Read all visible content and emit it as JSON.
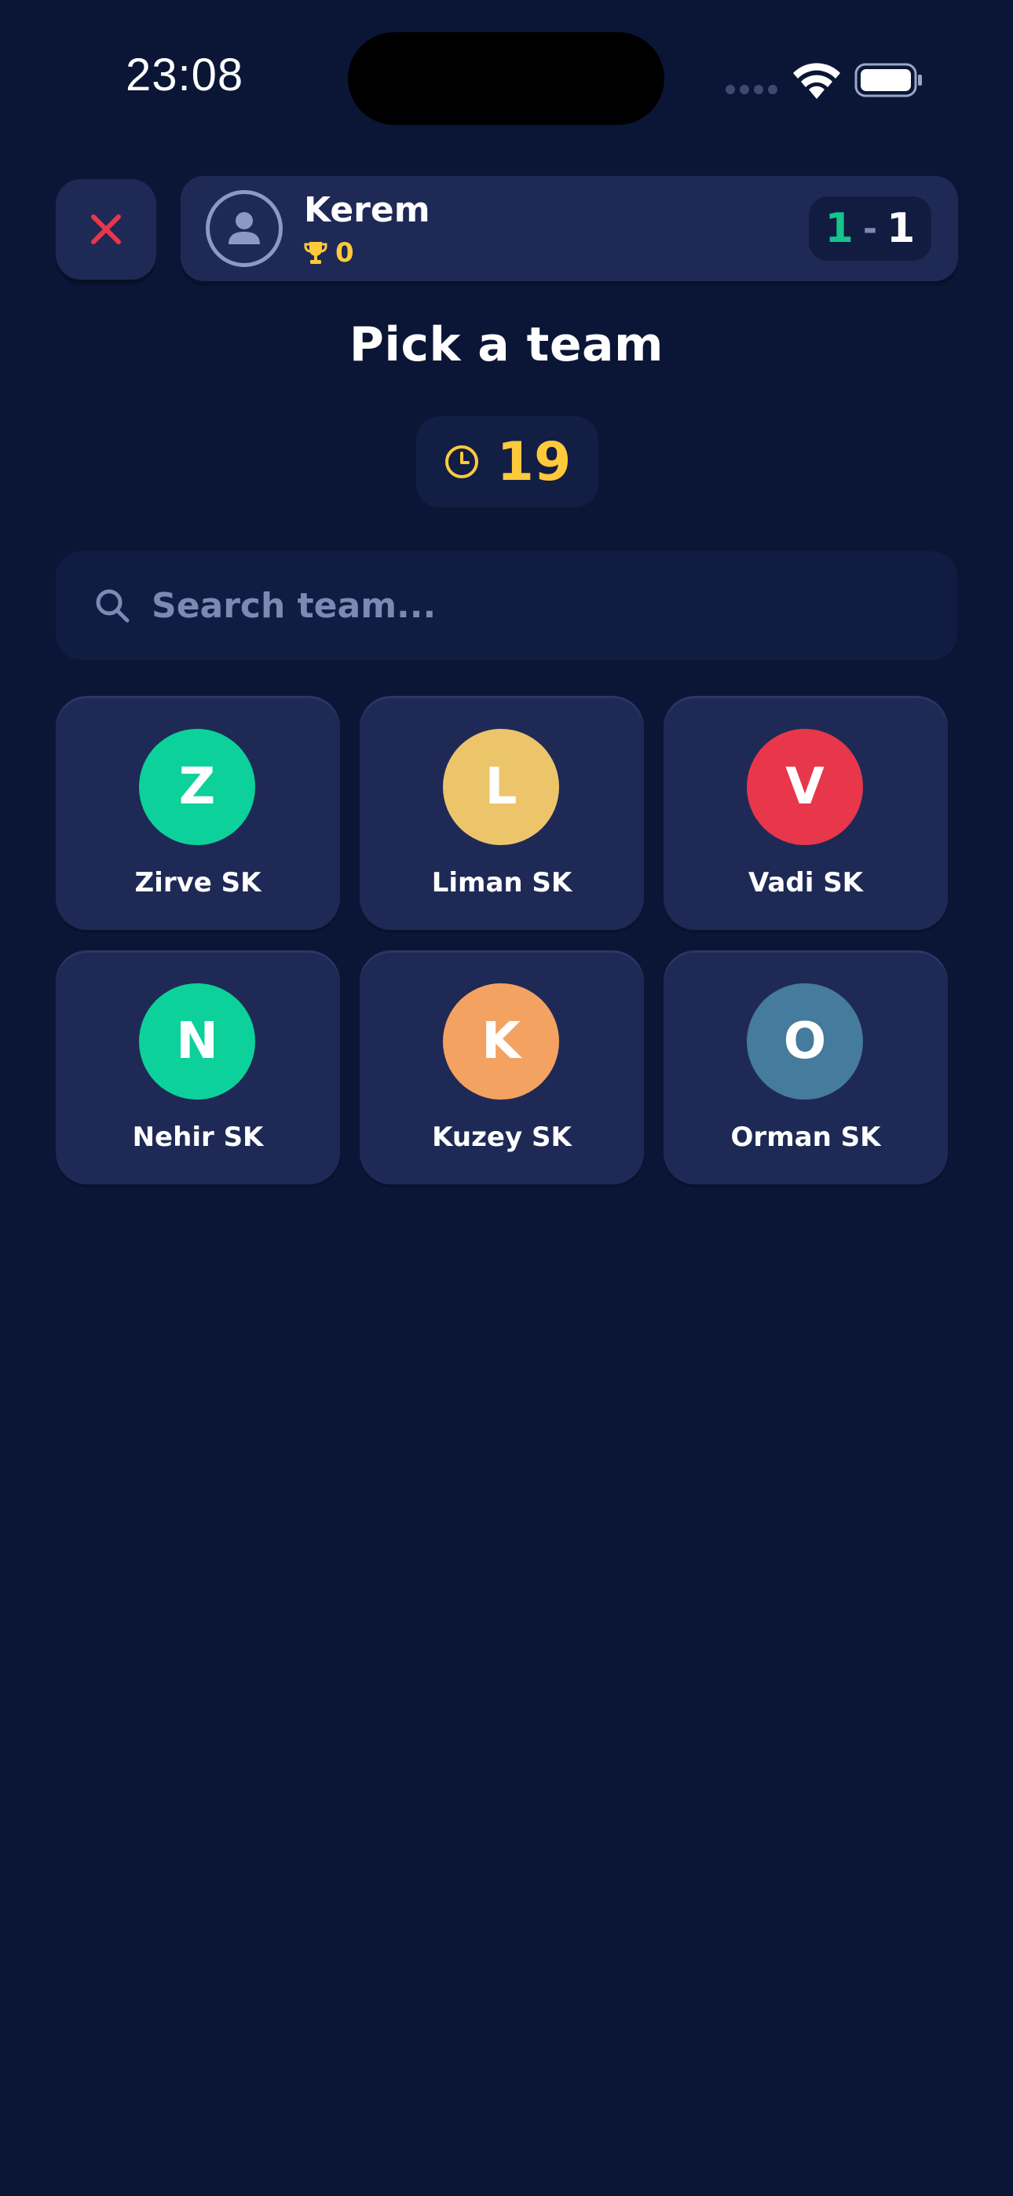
{
  "status_bar": {
    "time": "23:08"
  },
  "header": {
    "close_icon": "close-icon",
    "player": {
      "name": "Kerem",
      "trophies": "0",
      "avatar_icon": "user-icon"
    },
    "score": {
      "left": "1",
      "separator": "-",
      "right": "1"
    }
  },
  "title": "Pick a team",
  "timer": {
    "icon": "clock-icon",
    "value": "19"
  },
  "search": {
    "placeholder": "Search team...",
    "value": ""
  },
  "teams": [
    {
      "initial": "Z",
      "name": "Zirve SK",
      "color": "#0dd19a"
    },
    {
      "initial": "L",
      "name": "Liman SK",
      "color": "#ecc46a"
    },
    {
      "initial": "V",
      "name": "Vadi SK",
      "color": "#e8374a"
    },
    {
      "initial": "N",
      "name": "Nehir SK",
      "color": "#0dd19a"
    },
    {
      "initial": "K",
      "name": "Kuzey SK",
      "color": "#f4a261"
    },
    {
      "initial": "O",
      "name": "Orman SK",
      "color": "#457b9d"
    }
  ],
  "colors": {
    "background": "#0b1636",
    "card": "#1e2a55",
    "accent_yellow": "#ffc93c",
    "close_red": "#e8374a",
    "score_green": "#14c48b"
  }
}
